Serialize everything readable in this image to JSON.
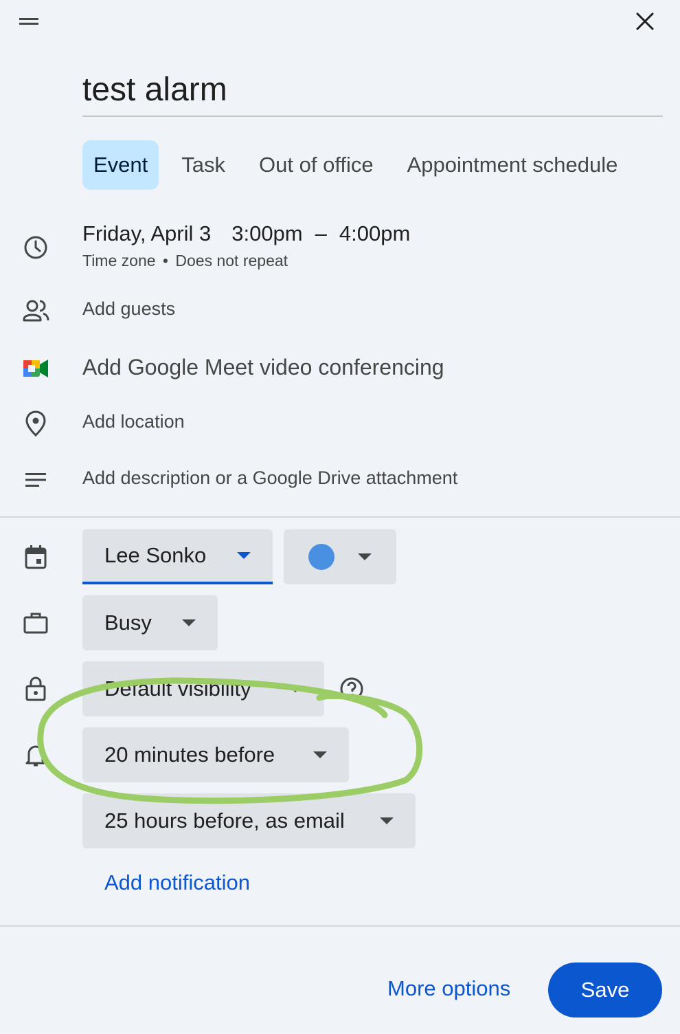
{
  "event": {
    "title_value": "test alarm",
    "tabs": [
      {
        "label": "Event",
        "active": true
      },
      {
        "label": "Task",
        "active": false
      },
      {
        "label": "Out of office",
        "active": false
      },
      {
        "label": "Appointment schedule",
        "active": false
      }
    ],
    "date": "Friday, April 3",
    "start_time": "3:00pm",
    "dash": "–",
    "end_time": "4:00pm",
    "time_zone_link": "Time zone",
    "separator": "•",
    "repeat_link": "Does not repeat"
  },
  "actions": {
    "add_guests": "Add guests",
    "add_meet": "Add Google Meet video conferencing",
    "add_location": "Add location",
    "add_description": "Add description or a Google Drive attachment"
  },
  "settings": {
    "calendar_owner": "Lee Sonko",
    "event_color": "#4a90e2",
    "availability": "Busy",
    "visibility": "Default visibility",
    "notifications": [
      "20 minutes before",
      "25 hours before, as email"
    ],
    "add_notification": "Add notification"
  },
  "footer": {
    "more_options": "More options",
    "save": "Save"
  },
  "colors": {
    "accent": "#0b57d0",
    "active_tab_bg": "#c2e7ff",
    "annotation_stroke": "#9ccc65"
  },
  "icons": [
    "drag-handle-icon",
    "close-icon",
    "clock-icon",
    "guests-icon",
    "google-meet-icon",
    "location-pin-icon",
    "description-icon",
    "calendar-icon",
    "briefcase-icon",
    "lock-icon",
    "help-icon",
    "bell-icon"
  ]
}
